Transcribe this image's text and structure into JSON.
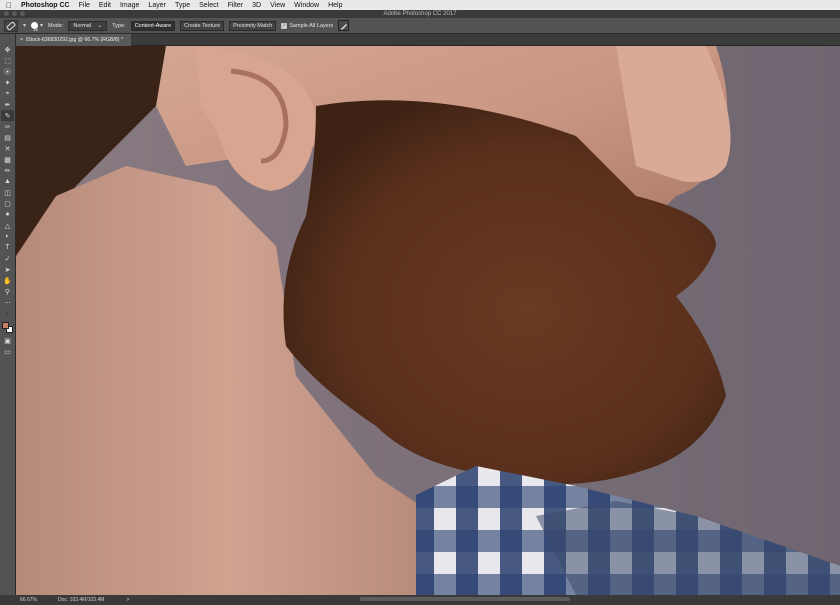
{
  "menubar": {
    "apple": "",
    "app": "Photoshop CC",
    "items": [
      "File",
      "Edit",
      "Image",
      "Layer",
      "Type",
      "Select",
      "Filter",
      "3D",
      "View",
      "Window",
      "Help"
    ]
  },
  "window": {
    "title": "Adobe Photoshop CC 2017"
  },
  "options": {
    "brush_size": "15",
    "mode_label": "Mode:",
    "mode_value": "Normal",
    "type_label": "Type:",
    "type_buttons": [
      "Content-Aware",
      "Create Texture",
      "Proximity Match"
    ],
    "type_selected": "Content-Aware",
    "sample_all_layers": "Sample All Layers",
    "sample_all_layers_checked": true
  },
  "document": {
    "tab_label": "iStock-636830292.jpg @ 66.7% (RGB/8) *",
    "close": "×"
  },
  "toolbar": {
    "tools": [
      "move-tool",
      "marquee-tool",
      "lasso-tool",
      "quick-selection-tool",
      "crop-tool",
      "eyedropper-tool",
      "spot-healing-brush-tool",
      "brush-tool",
      "clone-stamp-tool",
      "history-brush-tool",
      "eraser-tool",
      "gradient-tool",
      "blur-tool",
      "dodge-tool",
      "pen-tool",
      "type-tool",
      "path-selection-tool",
      "rectangle-tool",
      "hand-tool",
      "zoom-tool",
      "more-tools"
    ],
    "selected": "spot-healing-brush-tool",
    "foreground_color": "#c87e64",
    "background_color": "#ffffff"
  },
  "status": {
    "zoom": "66.67%",
    "doc": "Doc: 103.4M/103.4M",
    "arrow": ">"
  },
  "colors": {
    "panel": "#535353",
    "dark": "#282828"
  }
}
